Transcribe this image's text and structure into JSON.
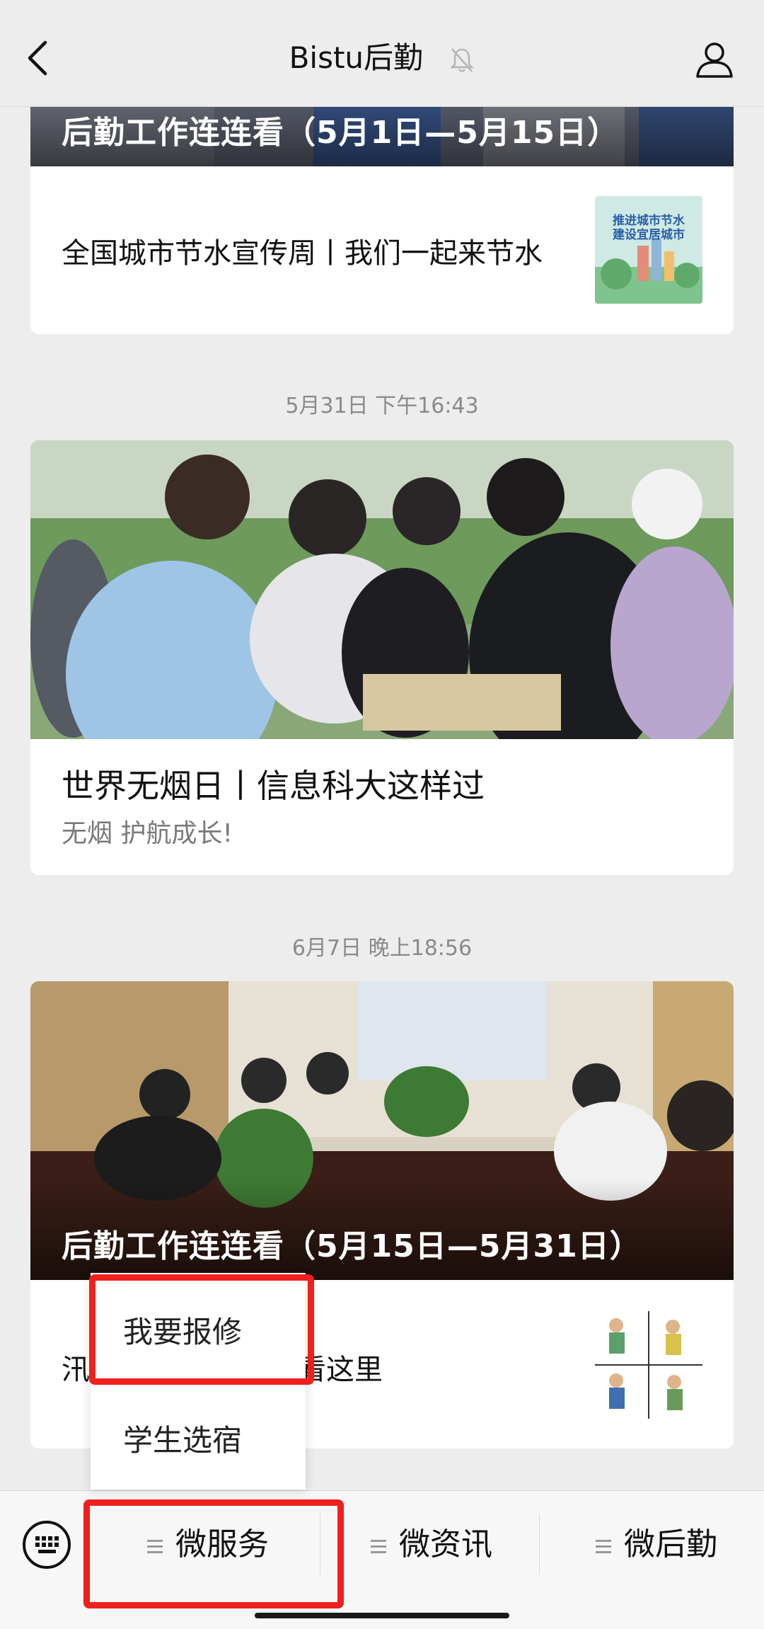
{
  "header": {
    "title": "Bistu后勤"
  },
  "feed": {
    "card1": {
      "hero_title": "后勤工作连连看（5月1日—5月15日）",
      "row_text": "全国城市节水宣传周丨我们一起来节水",
      "thumb_text": [
        "推进城市节水",
        "建设宜居城市"
      ]
    },
    "timestamp1": "5月31日 下午16:43",
    "card2": {
      "title": "世界无烟日丨信息科大这样过",
      "desc": "无烟 护航成长!"
    },
    "timestamp2": "6月7日 晚上18:56",
    "card3": {
      "hero_title": "后勤工作连连看（5月15日—5月31日）",
      "row_text_left": "汛",
      "row_text_right": "看这里"
    }
  },
  "popup": {
    "items": [
      "我要报修",
      "学生选宿"
    ]
  },
  "bottom_menu": {
    "items": [
      "微服务",
      "微资讯",
      "微后勤"
    ]
  },
  "colors": {
    "highlight": "#f0201c",
    "background": "#ededed"
  }
}
